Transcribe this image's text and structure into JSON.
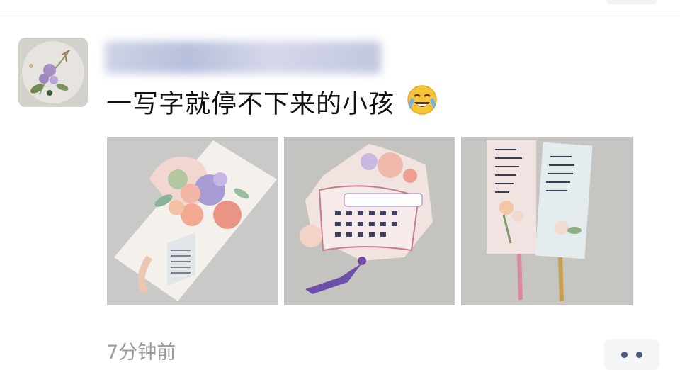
{
  "post": {
    "author_name": "",
    "text": "一写字就停不下来的小孩",
    "emoji": "face-with-tears-of-joy",
    "images": [
      {
        "subject": "floral-card"
      },
      {
        "subject": "fan-bookmark"
      },
      {
        "subject": "paper-bookmarks"
      }
    ],
    "timestamp": "7分钟前"
  },
  "colors": {
    "text": "#111111",
    "timestamp": "#9a9a9a",
    "more_button_bg": "#f4f5f7",
    "more_dots": "#4d5a7d"
  },
  "icons": {
    "more": "more-dots-icon"
  }
}
